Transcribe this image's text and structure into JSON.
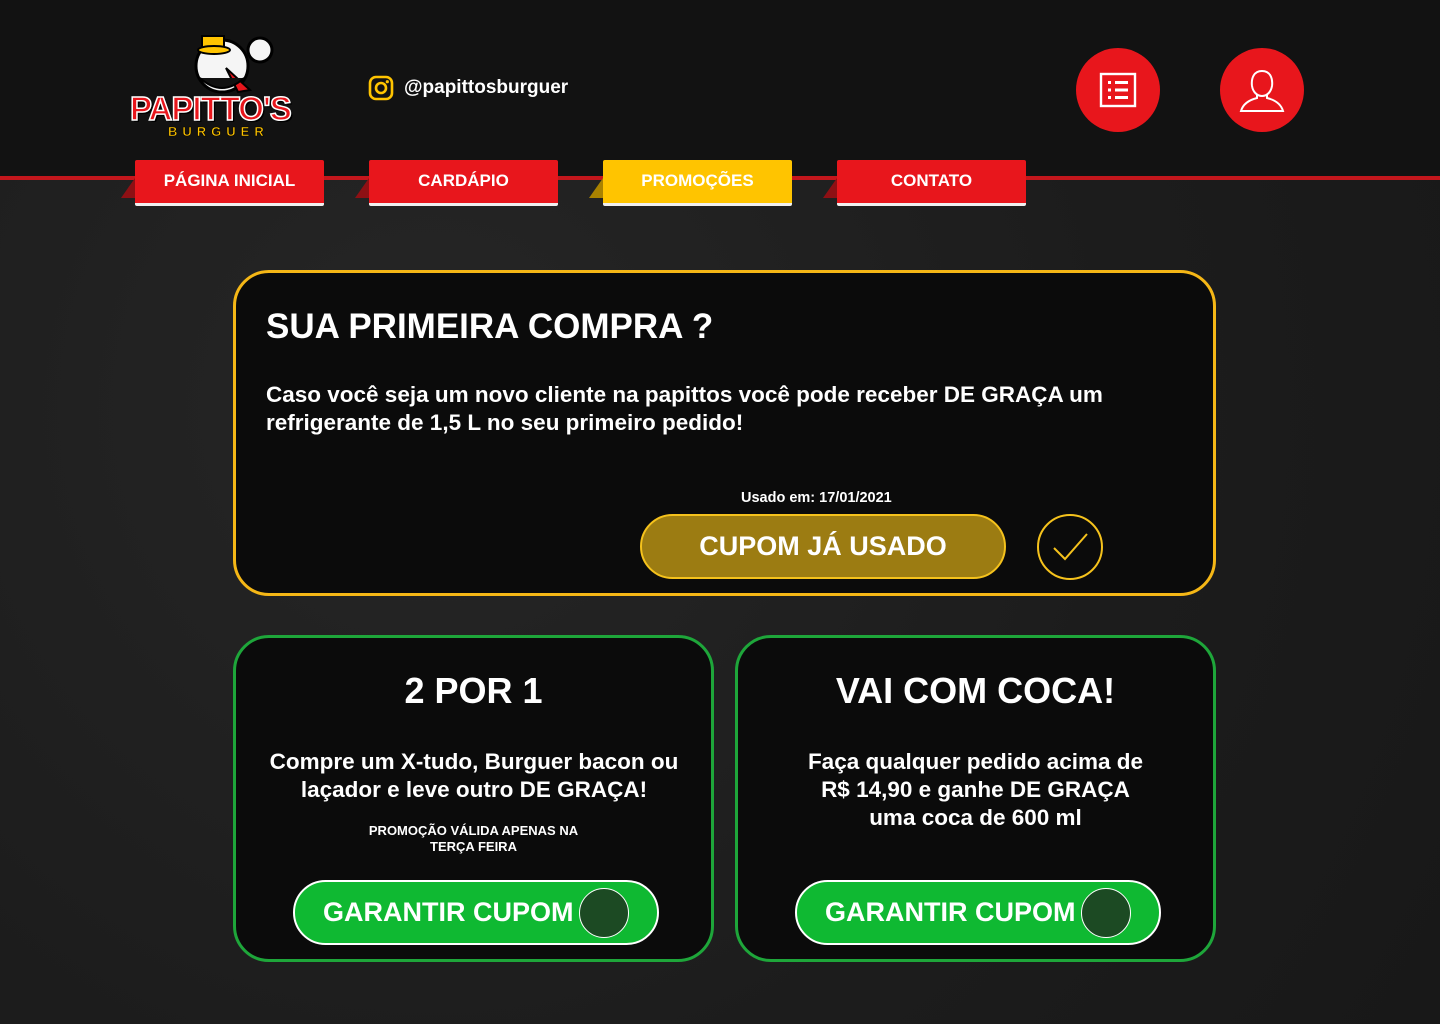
{
  "brand": {
    "name": "PAPITTO'S",
    "sub": "BURGUER"
  },
  "social": {
    "instagram": "@papittosburguer"
  },
  "nav": {
    "tabs": [
      {
        "label": "PÁGINA INICIAL"
      },
      {
        "label": "CARDÁPIO"
      },
      {
        "label": "PROMOÇÕES"
      },
      {
        "label": "CONTATO"
      }
    ]
  },
  "promos": {
    "first": {
      "title": "SUA PRIMEIRA COMPRA ?",
      "description": "Caso você seja um novo cliente na papittos você pode receber DE GRAÇA um refrigerante de 1,5 L no seu primeiro pedido!",
      "used_label": "Usado em: 17/01/2021",
      "button": "CUPOM JÁ USADO"
    },
    "two_for_one": {
      "title": "2 POR 1",
      "description": "Compre um X-tudo, Burguer bacon ou laçador e leve outro DE GRAÇA!",
      "note_line1": "PROMOÇÃO VÁLIDA APENAS NA",
      "note_line2": "TERÇA FEIRA",
      "button": "GARANTIR CUPOM"
    },
    "coca": {
      "title": "VAI COM COCA!",
      "description_line1": "Faça qualquer pedido acima de",
      "description_line2": "R$ 14,90 e ganhe DE GRAÇA",
      "description_line3": "uma coca de 600 ml",
      "button": "GARANTIR CUPOM"
    }
  },
  "colors": {
    "red": "#e8161c",
    "yellow": "#ffc400",
    "green": "#0fb932",
    "gold_used": "#9c7c12"
  }
}
